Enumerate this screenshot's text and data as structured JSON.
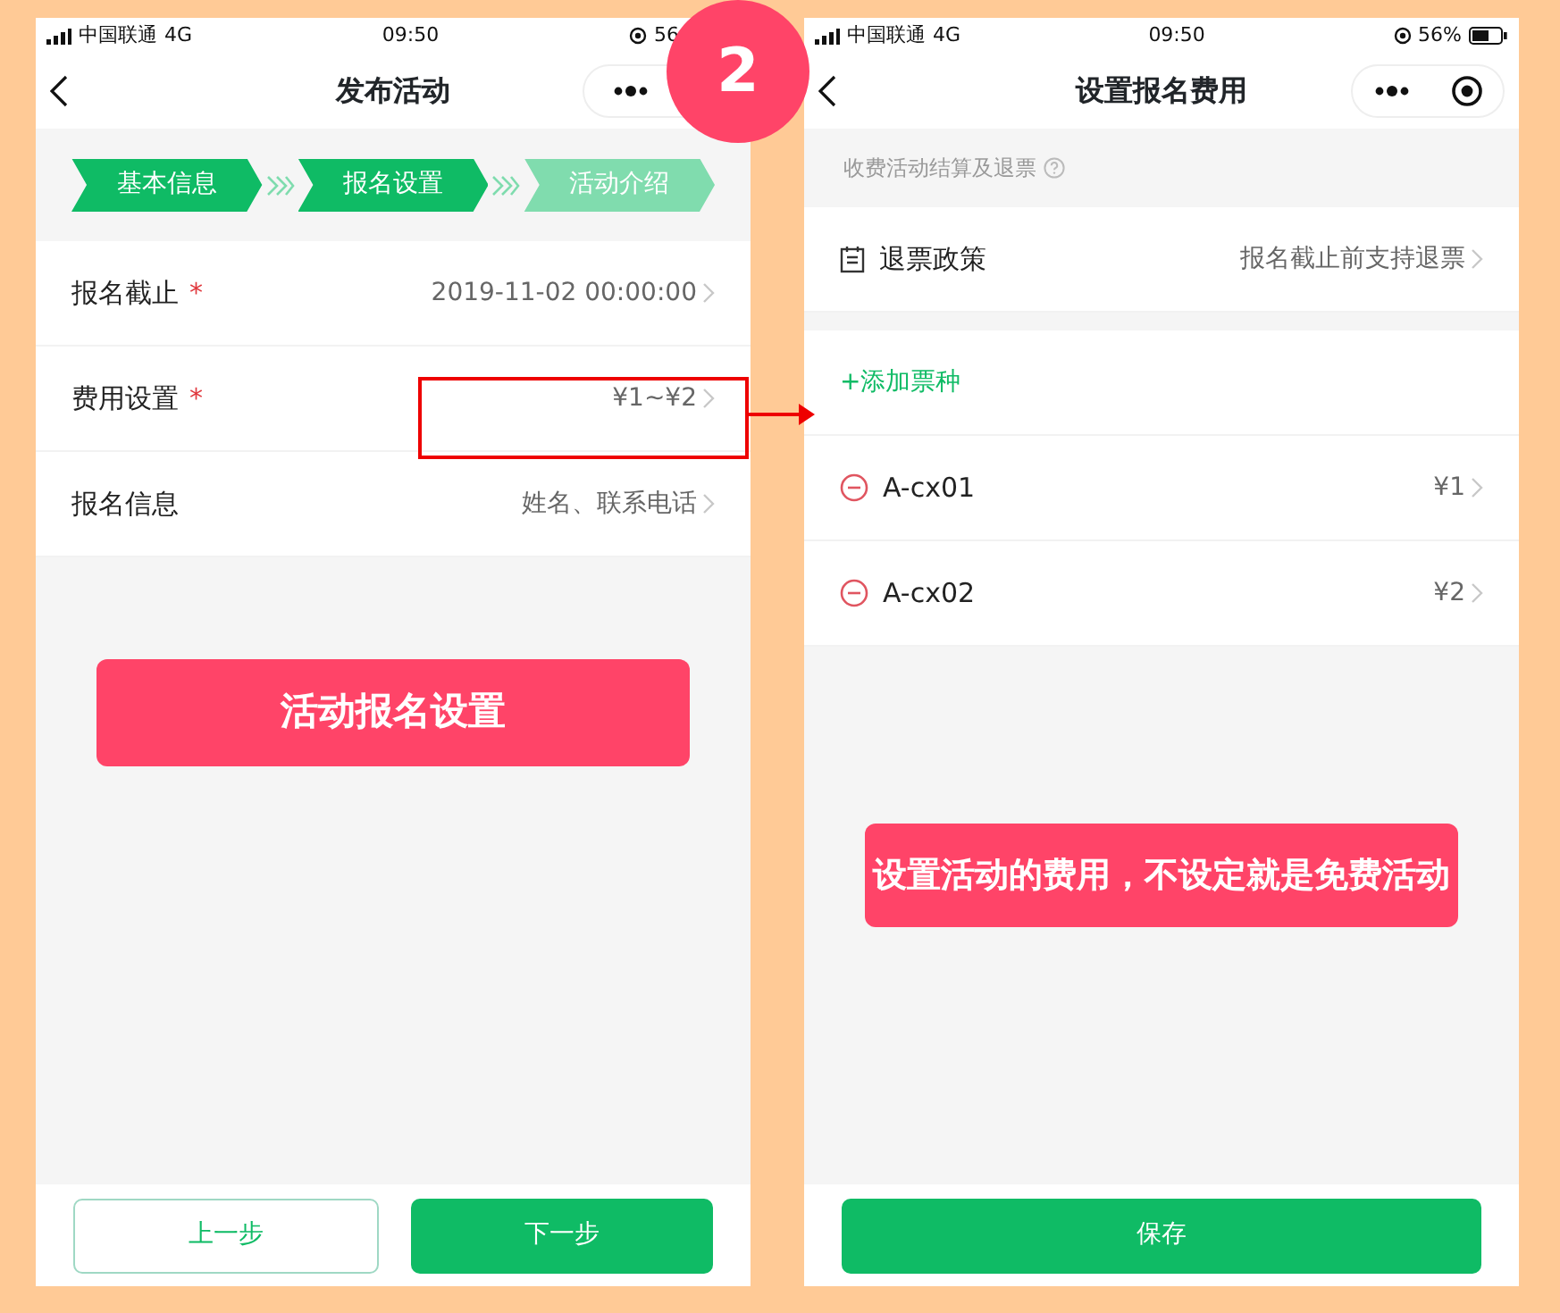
{
  "badge": "2",
  "left_screen": {
    "status": {
      "carrier": "中国联通",
      "network": "4G",
      "time": "09:50",
      "battery": "56"
    },
    "title": "发布活动",
    "steps": [
      {
        "label": "基本信息",
        "completed": true
      },
      {
        "label": "报名设置",
        "completed": true
      },
      {
        "label": "活动介绍",
        "completed": false
      }
    ],
    "rows": [
      {
        "label": "报名截止",
        "mark": "*",
        "value": "2019-11-02 00:00:00"
      },
      {
        "label": "费用设置",
        "mark": "*",
        "value": "¥1~¥2"
      },
      {
        "label": "报名信息",
        "value": "姓名、联系电话"
      }
    ],
    "buttons": [
      {
        "label": "上一步",
        "kind": "outline"
      },
      {
        "label": "下一步",
        "kind": "primary"
      }
    ],
    "callout": "活动报名设置"
  },
  "right_screen": {
    "status": {
      "carrier": "中国联通",
      "network": "4G",
      "time": "09:50",
      "battery": "56%"
    },
    "title": "设置报名费用",
    "section_header": "收费活动结算及退票",
    "policy": {
      "label": "退票政策",
      "value": "报名截止前支持退票"
    },
    "add_link": "+添加票种",
    "tickets": [
      {
        "name": "A-cx01",
        "price": "¥1"
      },
      {
        "name": "A-cx02",
        "price": "¥2"
      }
    ],
    "save_button": "保存",
    "callout": "设置活动的费用，不设定就是免费活动"
  }
}
